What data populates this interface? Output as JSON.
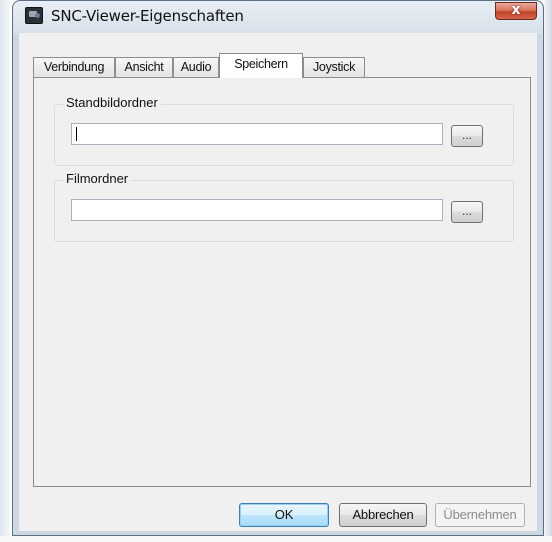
{
  "window": {
    "title": "SNC-Viewer-Eigenschaften",
    "close_label": "x"
  },
  "tabs": [
    {
      "label": "Verbindung",
      "active": false
    },
    {
      "label": "Ansicht",
      "active": false
    },
    {
      "label": "Audio",
      "active": false
    },
    {
      "label": "Speichern",
      "active": true
    },
    {
      "label": "Joystick",
      "active": false
    }
  ],
  "groups": {
    "still_folder": {
      "label": "Standbildordner",
      "value": "",
      "browse_label": "..."
    },
    "movie_folder": {
      "label": "Filmordner",
      "value": "",
      "browse_label": "..."
    }
  },
  "buttons": {
    "ok": "OK",
    "cancel": "Abbrechen",
    "apply": "Übernehmen"
  }
}
